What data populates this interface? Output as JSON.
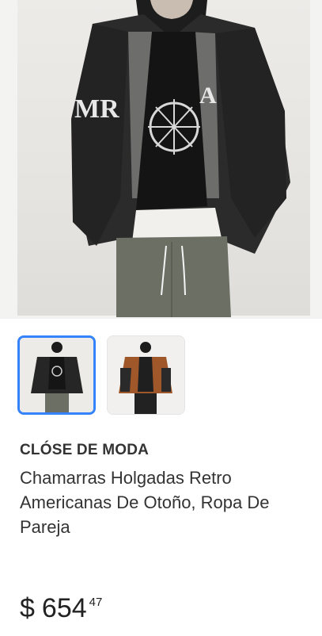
{
  "product": {
    "brand": "CLÓSE DE MODA",
    "title": "Chamarras Holgadas Retro Americanas De Otoño, Ropa De Pareja",
    "price": {
      "currency": "$",
      "integer": "654",
      "cents": "47"
    }
  },
  "gallery": {
    "selected_index": 0,
    "thumbnails": [
      {
        "name": "black-varsity-jacket",
        "selected": true
      },
      {
        "name": "brown-varsity-jacket",
        "selected": false
      }
    ]
  },
  "colors": {
    "selected_border": "#3483fa",
    "text": "#333333"
  }
}
